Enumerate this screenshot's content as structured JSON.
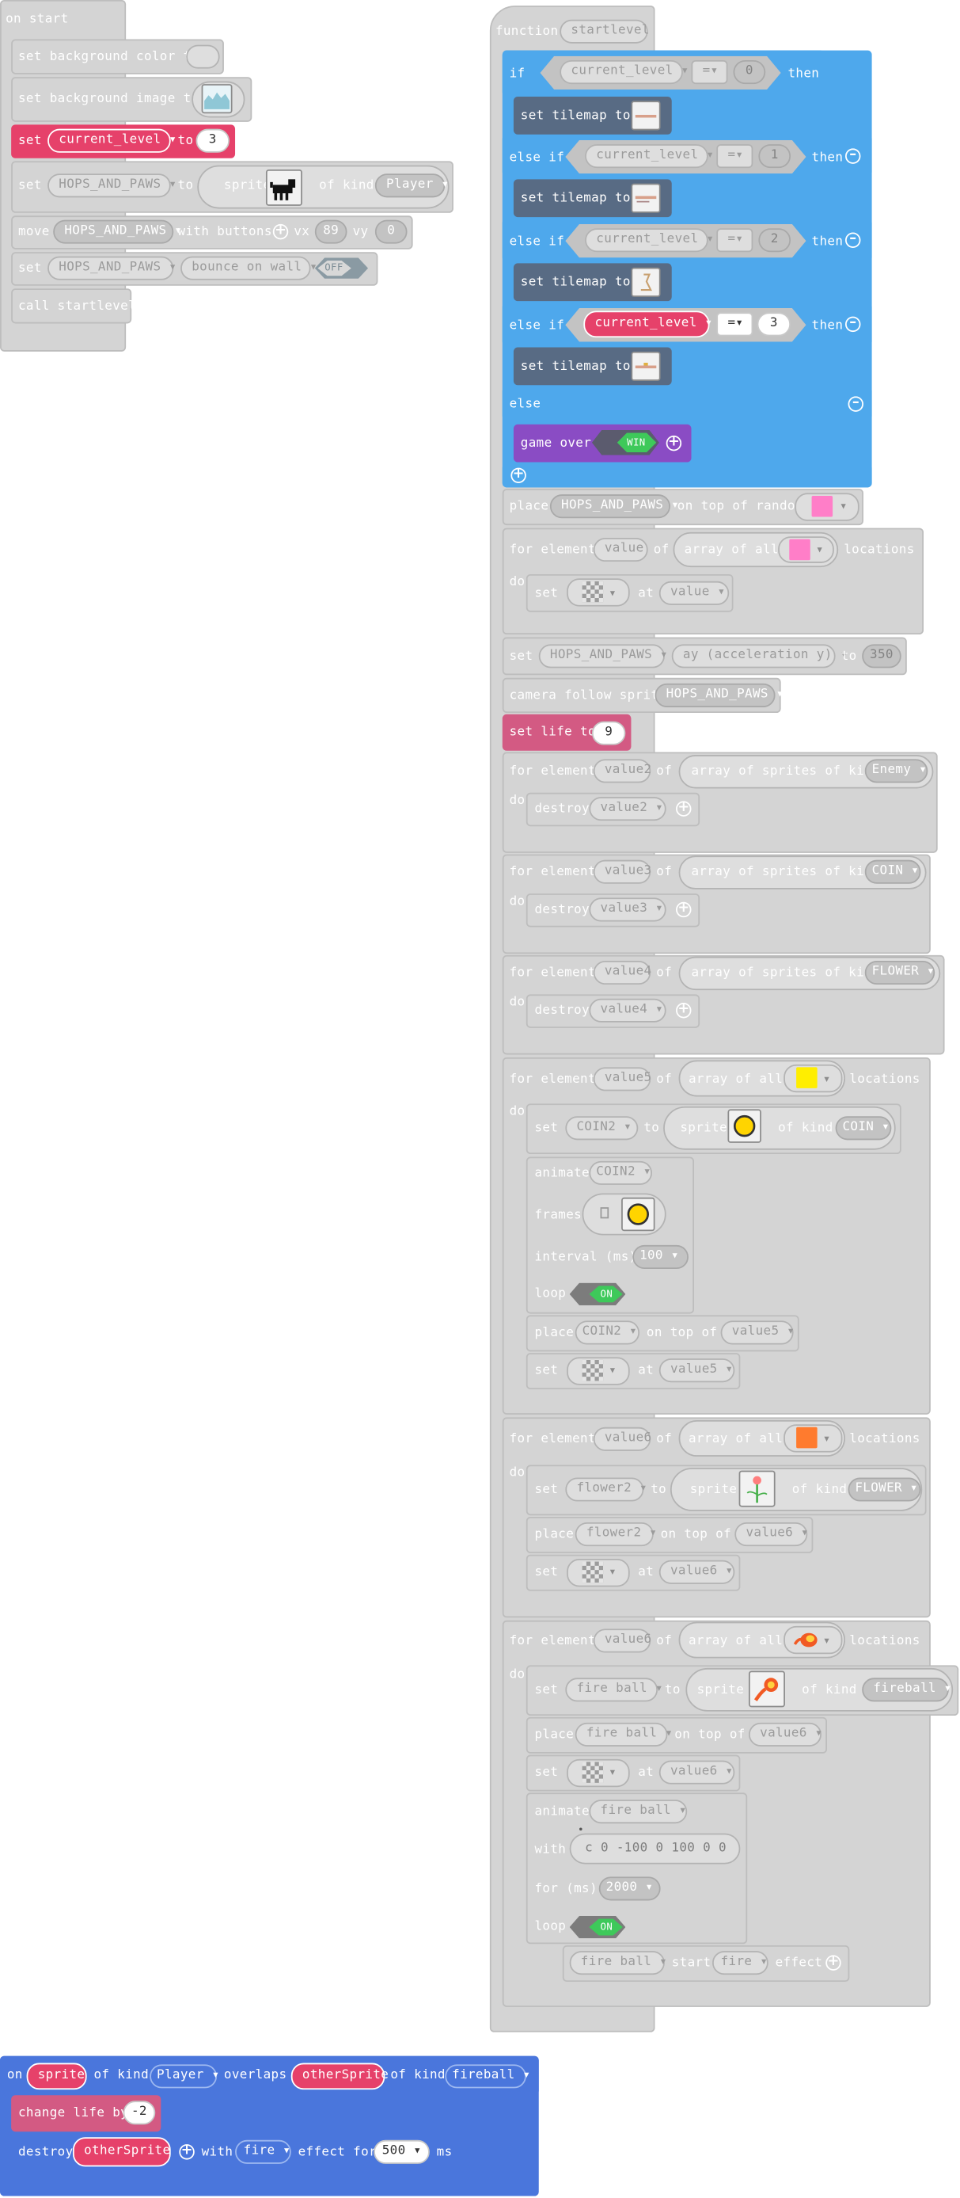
{
  "colors": {
    "editor_bg": "#ffffff",
    "logic": "#4ea8ec",
    "tilemap": "#586b84",
    "variables": "#e6416a",
    "info": "#d35a83",
    "game": "#8a4cc4",
    "sprites": "#4a76dc",
    "disabled": "#d4d4d4"
  },
  "on_start": {
    "header": "on start",
    "bg_color": "set background color to",
    "bg_image": "set background image to",
    "set_kw": "set",
    "var_current_level": "current_level",
    "to_kw": "to",
    "level_value": "3",
    "hops": "HOPS_AND_PAWS",
    "sprite_kw": "sprite",
    "of_kind_kw": "of kind",
    "kind_player": "Player",
    "move_kw": "move",
    "with_buttons_kw": "with buttons",
    "vx_kw": "vx",
    "vx_val": "89",
    "vy_kw": "vy",
    "vy_val": "0",
    "bounce_opt": "bounce on wall",
    "off_label": "OFF",
    "call_label": "call startlevel"
  },
  "function": {
    "header_kw": "function",
    "name": "startlevel",
    "if_kw": "if",
    "else_if_kw": "else if",
    "else_kw": "else",
    "then_kw": "then",
    "eq_op": "=",
    "compare_values": [
      "0",
      "1",
      "2",
      "3"
    ],
    "set_tilemap": "set tilemap to",
    "game_over": "game over",
    "win_label": "WIN",
    "place_kw": "place",
    "on_top_random": "on top of random",
    "for_element_kw": "for element",
    "of_kw": "of",
    "array_all": "array of all",
    "locations_kw": "locations",
    "do_kw": "do",
    "at_kw": "at",
    "v_value": "value",
    "v_value2": "value2",
    "v_value3": "value3",
    "v_value4": "value4",
    "v_value5": "value5",
    "v_value6": "value6",
    "ay_opt": "ay (acceleration y)",
    "ay_val": "350",
    "camera_follow": "camera follow sprite",
    "set_life": "set life to",
    "life_val": "9",
    "array_sprites_kind": "array of sprites of kind",
    "kind_enemy": "Enemy",
    "kind_coin": "COIN",
    "kind_flower": "FLOWER",
    "kind_fireball": "fireball",
    "destroy_kw": "destroy",
    "coin2": "COIN2",
    "flower2": "flower2",
    "fire_ball": "fire ball",
    "animate_kw": "animate",
    "frames_kw": "frames",
    "interval_kw": "interval (ms)",
    "interval_val": "100",
    "loop_kw": "loop",
    "on_label": "ON",
    "on_top_of_kw": "on top of",
    "with_kw": "with",
    "anim_path": "c  0 -100 0 100 0 0",
    "for_ms_kw": "for (ms)",
    "for_ms_val": "2000",
    "start_kw": "start",
    "effect_kw": "effect",
    "effect_fire": "fire",
    "tile_colors": {
      "magenta": "#ff7ec8",
      "yellow": "#ffee00",
      "orange": "#ff7b2e"
    }
  },
  "overlap": {
    "on_kw": "on",
    "sprite_kw": "sprite",
    "of_kind_kw": "of kind",
    "kind_player": "Player",
    "overlaps_kw": "overlaps",
    "other_sprite": "otherSprite",
    "kind_fireball": "fireball",
    "change_life": "change life by",
    "change_val": "-2",
    "destroy_kw": "destroy",
    "with_kw": "with",
    "effect_opt": "fire",
    "effect_for": "effect for",
    "ms_val": "500",
    "ms_kw": "ms"
  }
}
